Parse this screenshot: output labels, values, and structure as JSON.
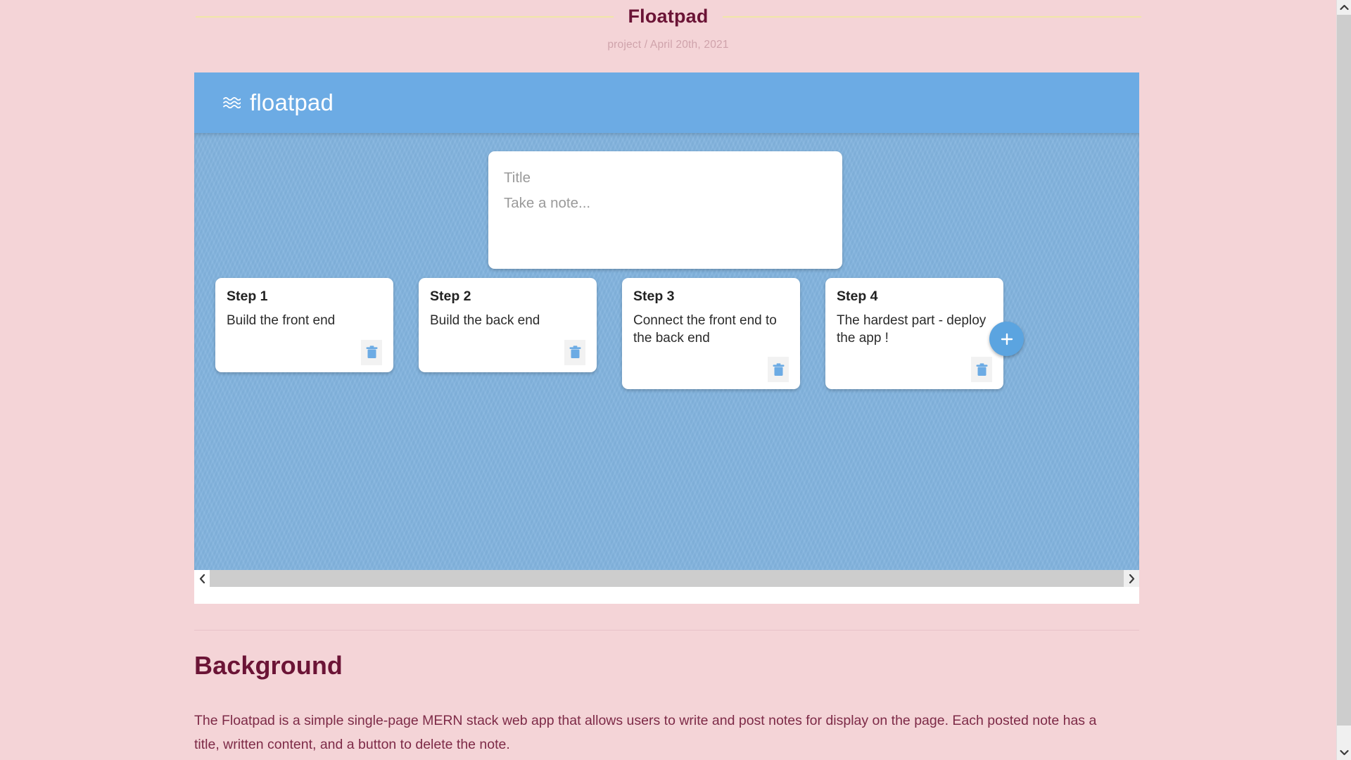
{
  "page": {
    "title": "Floatpad",
    "subtitle": "project / April 20th, 2021",
    "title_color": "#6b1436",
    "rule_color": "#f0e6a8",
    "background_color": "#f4d4d7"
  },
  "app": {
    "logo_text": "floatpad",
    "logo_icon": "wave-icon",
    "header_color": "#6cabe4",
    "body_color": "#82b3de",
    "composer": {
      "title_placeholder": "Title",
      "note_placeholder": "Take a note...",
      "title_value": "",
      "note_value": ""
    },
    "add_button": {
      "icon": "plus-icon",
      "label": "+",
      "color": "#5ba4e0"
    },
    "delete_icon": "trash-icon",
    "delete_icon_color": "#6cabe4",
    "notes": [
      {
        "title": "Step 1",
        "body": "Build the front end"
      },
      {
        "title": "Step 2",
        "body": "Build the back end"
      },
      {
        "title": "Step 3",
        "body": "Connect the front end to the back end"
      },
      {
        "title": "Step 4",
        "body": "The hardest part - deploy the app !"
      }
    ],
    "scrollbar": {
      "left_arrow": "chevron-left-icon",
      "right_arrow": "chevron-right-icon"
    }
  },
  "background_section": {
    "heading": "Background",
    "paragraph": "The Floatpad is a simple single-page MERN stack web app that allows users to write and post notes for display on the page. Each posted note has a title, written content, and a button to delete the note."
  },
  "page_scrollbar": {
    "up_arrow": "chevron-up-icon",
    "down_arrow": "chevron-down-icon"
  }
}
